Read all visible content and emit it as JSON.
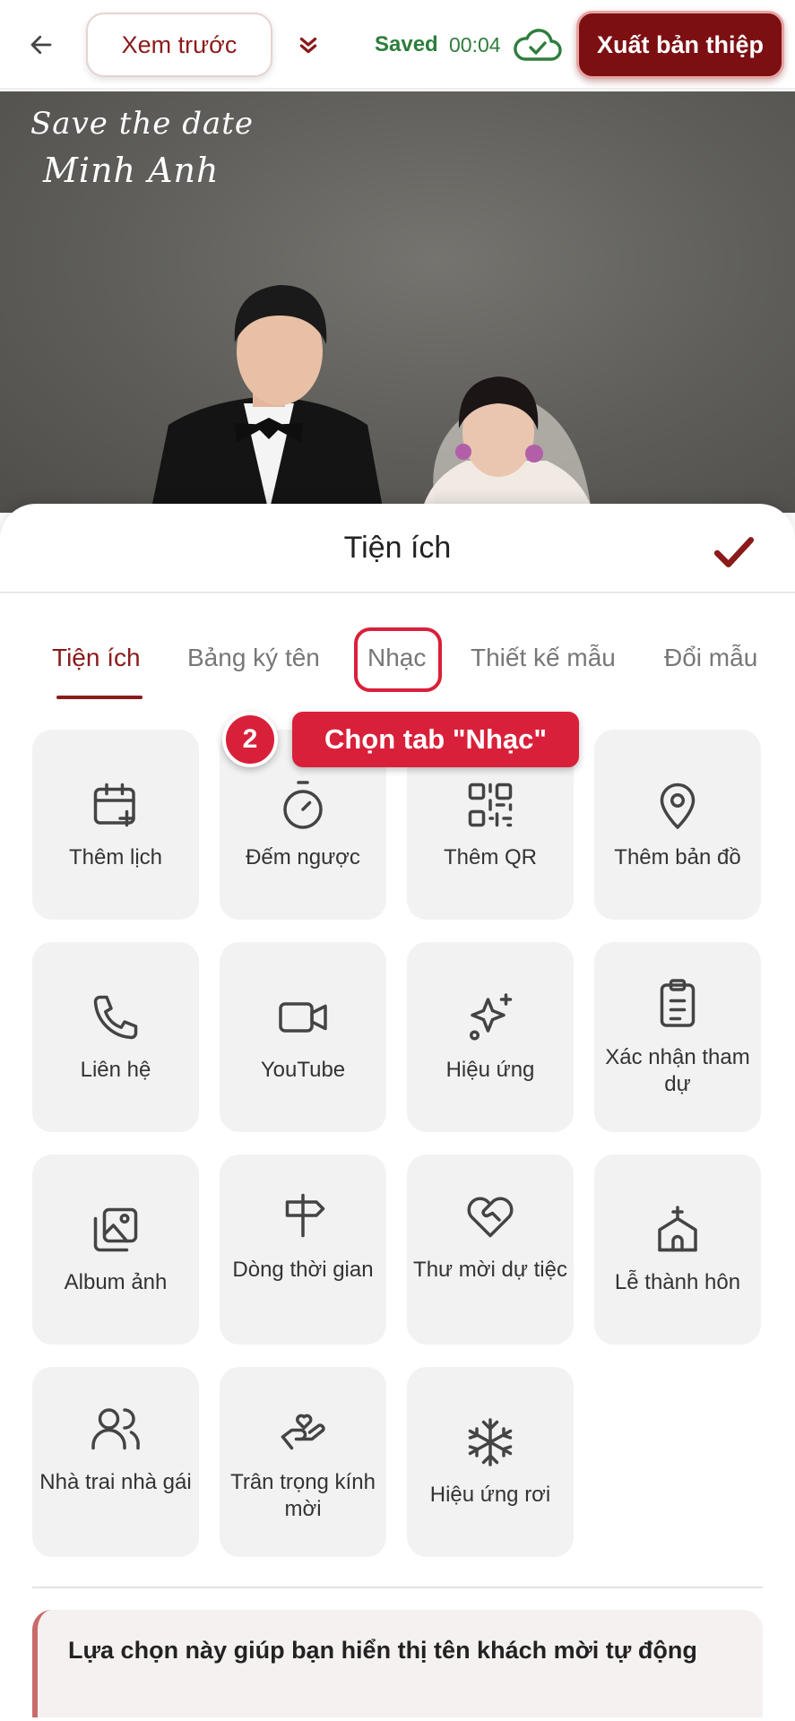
{
  "topbar": {
    "preview_label": "Xem trước",
    "saved_label": "Saved",
    "saved_time": "00:04",
    "export_label": "Xuất bản thiệp"
  },
  "hero": {
    "script_line1": "Save the date",
    "script_line2": "Minh Anh"
  },
  "sheet": {
    "title": "Tiện ích",
    "tabs": [
      {
        "label": "Tiện ích",
        "active": true
      },
      {
        "label": "Bảng ký tên"
      },
      {
        "label": "Nhạc"
      },
      {
        "label": "Thiết kế mẫu"
      },
      {
        "label": "Đổi mẫu"
      }
    ]
  },
  "callout": {
    "step": "2",
    "text": "Chọn tab \"Nhạc\""
  },
  "items": [
    {
      "label": "Thêm lịch",
      "icon": "calendar-add-icon"
    },
    {
      "label": "Đếm ngược",
      "icon": "timer-icon"
    },
    {
      "label": "Thêm QR",
      "icon": "qr-code-icon"
    },
    {
      "label": "Thêm bản đồ",
      "icon": "map-pin-icon"
    },
    {
      "label": "Liên hệ",
      "icon": "phone-icon"
    },
    {
      "label": "YouTube",
      "icon": "video-camera-icon"
    },
    {
      "label": "Hiệu ứng",
      "icon": "sparkles-icon"
    },
    {
      "label": "Xác nhận tham dự",
      "icon": "clipboard-list-icon"
    },
    {
      "label": "Album ảnh",
      "icon": "image-gallery-icon"
    },
    {
      "label": "Dòng thời gian",
      "icon": "signpost-icon"
    },
    {
      "label": "Thư mời dự tiệc",
      "icon": "heart-handshake-icon"
    },
    {
      "label": "Lễ thành hôn",
      "icon": "church-icon"
    },
    {
      "label": "Nhà trai nhà gái",
      "icon": "users-icon"
    },
    {
      "label": "Trân trọng kính mời",
      "icon": "hand-heart-icon"
    },
    {
      "label": "Hiệu ứng rơi",
      "icon": "snowflake-icon"
    }
  ],
  "note": {
    "text": "Lựa chọn này giúp bạn hiển thị tên khách mời tự động"
  },
  "colors": {
    "brand": "#7c0f12",
    "accent_red": "#d9203a",
    "saved_green": "#2e7d3c"
  }
}
